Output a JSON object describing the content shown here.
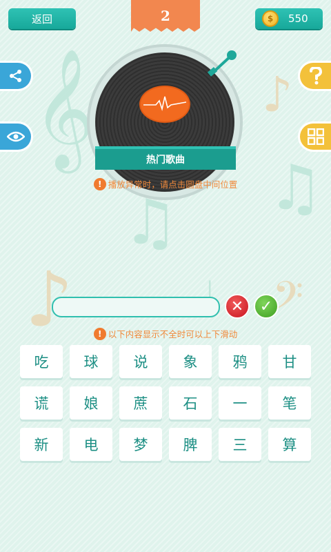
{
  "header": {
    "back_label": "返回",
    "level": "2",
    "coins": "550",
    "coin_icon": "dollar-coin-icon"
  },
  "side_buttons": {
    "share_icon": "share-icon",
    "eye_icon": "eye-icon",
    "hint_icon": "question-icon",
    "grid_icon": "grid-icon"
  },
  "player": {
    "category": "热门歌曲"
  },
  "hints": {
    "playback": "播放异常时，请点击圆盘中间位置",
    "scroll": "以下内容显示不全时可以上下滑动",
    "bang": "!"
  },
  "answer": {
    "value": "",
    "clear_symbol": "✕",
    "confirm_symbol": "✓"
  },
  "keys": [
    "吃",
    "球",
    "说",
    "象",
    "鸦",
    "甘",
    "谎",
    "娘",
    "蔗",
    "石",
    "一",
    "笔",
    "新",
    "电",
    "梦",
    "脾",
    "三",
    "算"
  ],
  "colors": {
    "accent": "#1ea89a",
    "banner": "#f2874f",
    "background": "#dff3ec"
  }
}
